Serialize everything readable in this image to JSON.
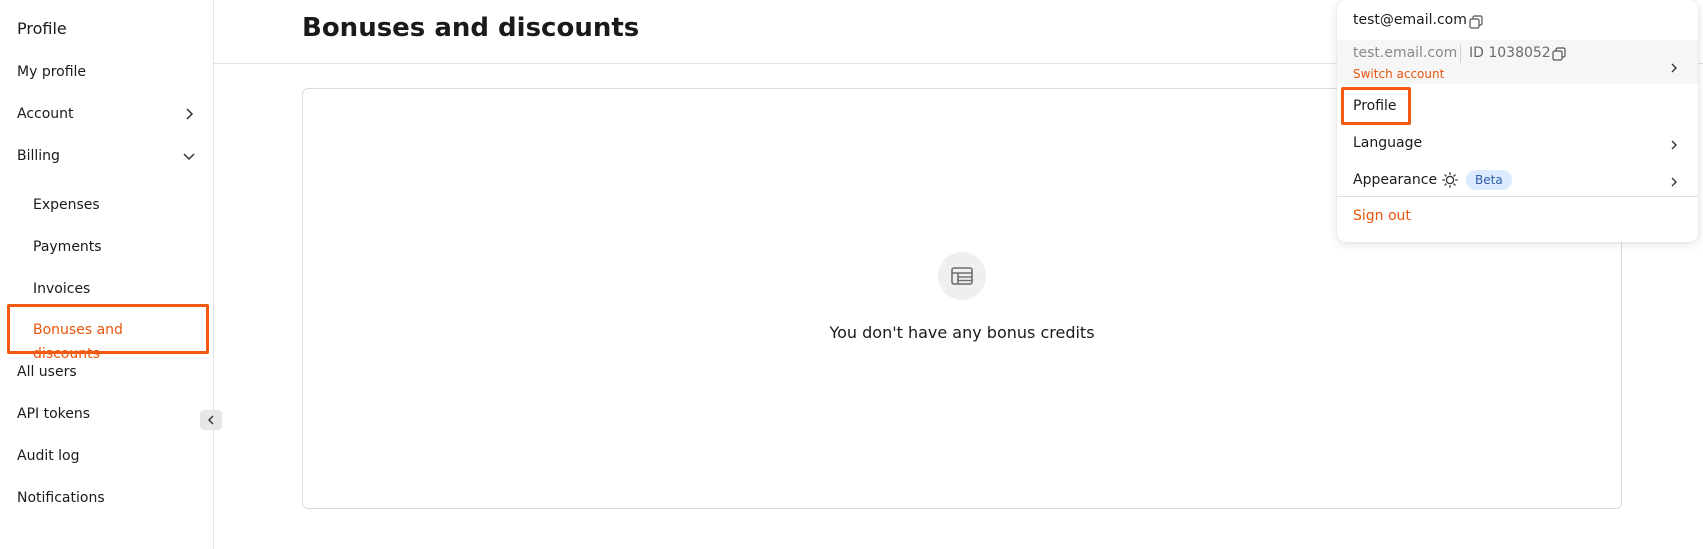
{
  "sidebar": {
    "title": "Profile",
    "items": [
      {
        "label": "My profile"
      },
      {
        "label": "Account"
      },
      {
        "label": "Billing"
      },
      {
        "label": "Expenses"
      },
      {
        "label": "Payments"
      },
      {
        "label": "Invoices"
      },
      {
        "label": "Bonuses and discounts"
      },
      {
        "label": "All users"
      },
      {
        "label": "API tokens"
      },
      {
        "label": "Audit log"
      },
      {
        "label": "Notifications"
      }
    ],
    "active_item": "Bonuses and discounts"
  },
  "main": {
    "title": "Bonuses and discounts",
    "empty_message": "You don't have any bonus credits",
    "empty_icon": "table-icon"
  },
  "user_menu": {
    "email": "test@email.com",
    "account_name": "test.email.com",
    "account_id": "ID 1038052",
    "switch_account": "Switch account",
    "profile": "Profile",
    "language": "Language",
    "appearance": "Appearance",
    "appearance_icon": "sun-icon",
    "beta_badge": "Beta",
    "sign_out": "Sign out"
  },
  "colors": {
    "accent": "#e8560c",
    "highlight_border": "#f15a10",
    "beta_bg": "#dbeafe",
    "beta_text": "#2d5fa8"
  }
}
